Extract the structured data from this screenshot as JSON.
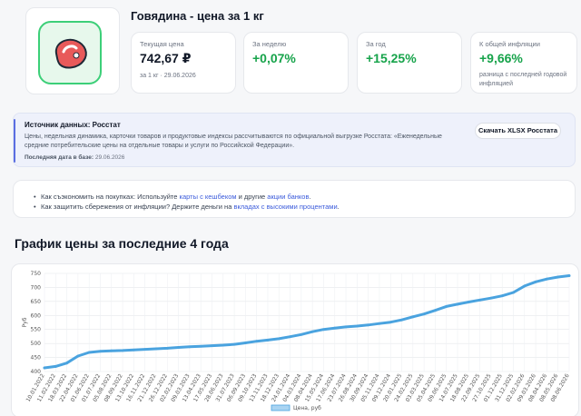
{
  "product": {
    "title": "Говядина - цена за 1 кг",
    "icon": "meat-steak-icon"
  },
  "stats": {
    "current": {
      "label": "Текущая цена",
      "value": "742,67 ₽",
      "sub": "за 1 кг · 29.06.2026"
    },
    "week": {
      "label": "За неделю",
      "value": "+0,07%"
    },
    "year": {
      "label": "За год",
      "value": "+15,25%"
    },
    "inflation": {
      "label": "К общей инфляции",
      "value": "+9,66%",
      "sub": "разница с последней годовой инфляцией"
    }
  },
  "colors": {
    "positive": "#16a34a",
    "accent": "#5b6ee1",
    "link": "#3b5bdb",
    "series": "#4aa3df"
  },
  "source": {
    "title": "Источник данных: Росстат",
    "description": "Цены, недельная динамика, карточки товаров и продуктовые индексы рассчитываются по официальной выгрузке Росстата: «Еженедельные средние потребительские цены на отдельные товары и услуги по Российской Федерации».",
    "date_label": "Последняя дата в базе:",
    "date_value": "29.06.2026",
    "button": "Скачать XLSX Росстата"
  },
  "tips": {
    "tip1": {
      "prefix": "Как съэкономить на покупках: Используйте ",
      "link1": "карты с кешбеком",
      "middle": " и другие ",
      "link2": "акции банков",
      "suffix": "."
    },
    "tip2": {
      "prefix": "Как защитить сбережения от инфляции? Держите деньги на ",
      "link": "вкладах с высокими процентами",
      "suffix": "."
    }
  },
  "chart_heading": "График цены за последние 4 года",
  "chart_data": {
    "type": "line",
    "ylabel": "Руб",
    "legend": "Цена, руб",
    "legend_position": "bottom",
    "ylim": [
      400,
      750
    ],
    "yticks": [
      400,
      450,
      500,
      550,
      600,
      650,
      700,
      750
    ],
    "grid": true,
    "x": [
      "10.01.2022",
      "11.02.2022",
      "18.03.2022",
      "22.04.2022",
      "01.06.2022",
      "01.07.2022",
      "05.08.2022",
      "08.09.2022",
      "13.10.2022",
      "16.11.2022",
      "21.12.2022",
      "26.12.2022",
      "02.02.2023",
      "09.03.2023",
      "13.04.2023",
      "17.05.2023",
      "28.06.2023",
      "31.07.2023",
      "06.09.2023",
      "09.10.2023",
      "13.11.2023",
      "18.12.2023",
      "24.01.2024",
      "04.03.2024",
      "08.04.2024",
      "15.05.2024",
      "17.06.2024",
      "23.07.2024",
      "26.08.2024",
      "30.09.2024",
      "05.11.2024",
      "09.12.2024",
      "20.01.2025",
      "24.02.2025",
      "03.03.2025",
      "05.04.2025",
      "09.06.2025",
      "14.07.2025",
      "18.08.2025",
      "22.09.2025",
      "27.10.2025",
      "01.12.2025",
      "31.12.2025",
      "02.02.2026",
      "09.03.2026",
      "08.04.2026",
      "08.05.2026",
      "08.06.2026"
    ],
    "values": [
      413,
      418,
      430,
      455,
      468,
      472,
      474,
      475,
      477,
      479,
      481,
      483,
      486,
      488,
      490,
      492,
      494,
      497,
      502,
      508,
      512,
      517,
      524,
      532,
      542,
      550,
      555,
      559,
      562,
      566,
      571,
      576,
      584,
      595,
      605,
      618,
      632,
      640,
      648,
      655,
      662,
      670,
      682,
      705,
      720,
      730,
      737,
      742
    ]
  }
}
